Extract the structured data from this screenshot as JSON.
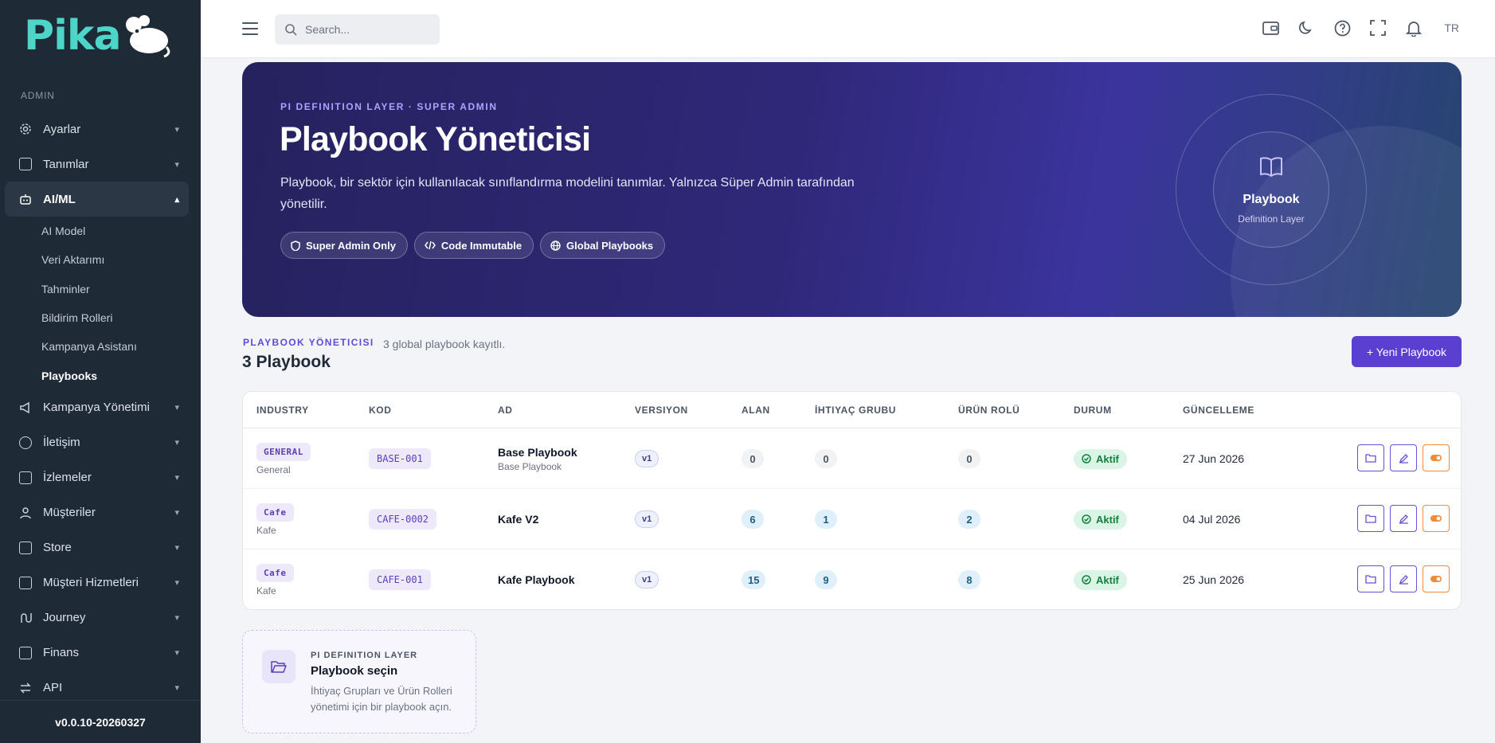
{
  "app": {
    "logo_text": "Pika",
    "version": "v0.0.10-20260327"
  },
  "sidebar": {
    "section_label": "ADMIN",
    "items": [
      {
        "label": "Ayarlar",
        "icon": "gear-icon"
      },
      {
        "label": "Tanımlar",
        "icon": "list-icon"
      },
      {
        "label": "AI/ML",
        "icon": "robot-icon",
        "active": true
      },
      {
        "label": "Kampanya Yönetimi",
        "icon": "megaphone-icon"
      },
      {
        "label": "İletişim",
        "icon": "chat-icon"
      },
      {
        "label": "İzlemeler",
        "icon": "report-icon"
      },
      {
        "label": "Müşteriler",
        "icon": "user-icon"
      },
      {
        "label": "Store",
        "icon": "store-icon"
      },
      {
        "label": "Müşteri Hizmetleri",
        "icon": "support-icon"
      },
      {
        "label": "Journey",
        "icon": "route-icon"
      },
      {
        "label": "Finans",
        "icon": "finance-icon"
      },
      {
        "label": "API",
        "icon": "api-icon"
      }
    ],
    "aiml_sub": [
      "AI Model",
      "Veri Aktarımı",
      "Tahminler",
      "Bildirim Rolleri",
      "Kampanya Asistanı",
      "Playbooks"
    ]
  },
  "topbar": {
    "search_placeholder": "Search...",
    "lang": "TR"
  },
  "hero": {
    "kicker": "PI DEFINITION LAYER · SUPER ADMIN",
    "title": "Playbook Yöneticisi",
    "description": "Playbook, bir sektör için kullanılacak sınıflandırma modelini tanımlar. Yalnızca Süper Admin tarafından yönetilir.",
    "chips": [
      "Super Admin Only",
      "Code Immutable",
      "Global Playbooks"
    ],
    "ring_title": "Playbook",
    "ring_sub": "Definition Layer"
  },
  "section": {
    "kicker": "PLAYBOOK YÖNETICISI",
    "count_text": "3 global playbook kayıtlı.",
    "title": "3 Playbook",
    "new_button": "+ Yeni Playbook"
  },
  "table": {
    "headers": [
      "INDUSTRY",
      "KOD",
      "AD",
      "VERSIYON",
      "ALAN",
      "İHTIYAÇ GRUBU",
      "ÜRÜN ROLÜ",
      "DURUM",
      "GÜNCELLEME"
    ],
    "rows": [
      {
        "industry": "GENERAL",
        "industry_sub": "General",
        "code": "BASE-001",
        "name": "Base Playbook",
        "name_sub": "Base Playbook",
        "version": "v1",
        "alan": "0",
        "ihtiyac": "0",
        "urun": "0",
        "status": "Aktif",
        "date": "27 Jun 2026"
      },
      {
        "industry": "Cafe",
        "industry_sub": "Kafe",
        "code": "CAFE-0002",
        "name": "Kafe V2",
        "name_sub": "",
        "version": "v1",
        "alan": "6",
        "ihtiyac": "1",
        "urun": "2",
        "status": "Aktif",
        "date": "04 Jul 2026"
      },
      {
        "industry": "Cafe",
        "industry_sub": "Kafe",
        "code": "CAFE-001",
        "name": "Kafe Playbook",
        "name_sub": "",
        "version": "v1",
        "alan": "15",
        "ihtiyac": "9",
        "urun": "8",
        "status": "Aktif",
        "date": "25 Jun 2026"
      }
    ]
  },
  "card": {
    "kicker": "PI DEFINITION LAYER",
    "title": "Playbook seçin",
    "description": "İhtiyaç Grupları ve Ürün Rolleri yönetimi için bir playbook açın."
  },
  "colors": {
    "accent": "#5b3fd1",
    "sidebar_bg": "#1f2a37",
    "logo": "#4dd5c8",
    "status_green": "#15803d",
    "warning": "#ef8b3a"
  }
}
